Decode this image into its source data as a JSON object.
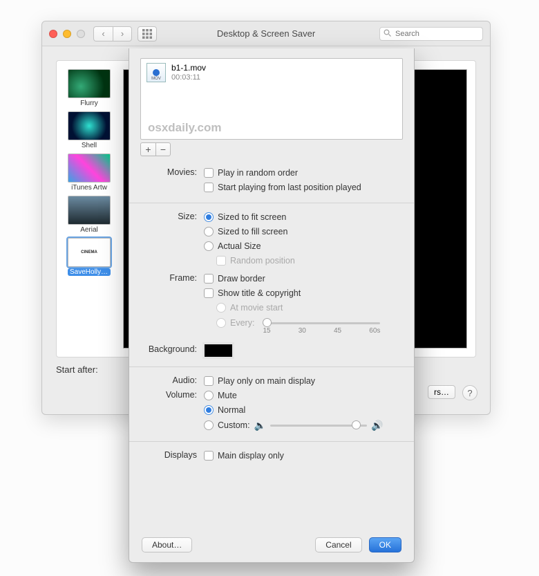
{
  "window": {
    "title": "Desktop & Screen Saver",
    "search_placeholder": "Search"
  },
  "sidebar_thumbs": [
    {
      "label": "Flurry"
    },
    {
      "label": "Shell"
    },
    {
      "label": "iTunes Artw"
    },
    {
      "label": "Aerial"
    },
    {
      "label": "SaveHollywo",
      "selected": true
    }
  ],
  "start_after_label": "Start after:",
  "options_button": "rs…",
  "sheet": {
    "movie_list": {
      "file_name": "b1-1.mov",
      "duration": "00:03:11",
      "watermark": "osxdaily.com"
    },
    "labels": {
      "movies": "Movies:",
      "size": "Size:",
      "frame": "Frame:",
      "background": "Background:",
      "audio": "Audio:",
      "volume": "Volume:",
      "displays": "Displays"
    },
    "movies_options": {
      "random": "Play in random order",
      "resume": "Start playing from last position played"
    },
    "size_options": {
      "fit": "Sized to fit screen",
      "fill": "Sized to fill screen",
      "actual": "Actual Size",
      "random_pos": "Random position"
    },
    "frame_options": {
      "border": "Draw border",
      "title": "Show title & copyright",
      "at_start": "At movie start",
      "every": "Every:"
    },
    "frame_ticks": {
      "t1": "15",
      "t2": "30",
      "t3": "45",
      "t4": "60s"
    },
    "audio_options": {
      "main_only": "Play only on main display"
    },
    "volume_options": {
      "mute": "Mute",
      "normal": "Normal",
      "custom": "Custom:"
    },
    "displays_options": {
      "main_display_only": "Main display only"
    },
    "buttons": {
      "about": "About…",
      "cancel": "Cancel",
      "ok": "OK"
    },
    "background_color": "#000000"
  }
}
